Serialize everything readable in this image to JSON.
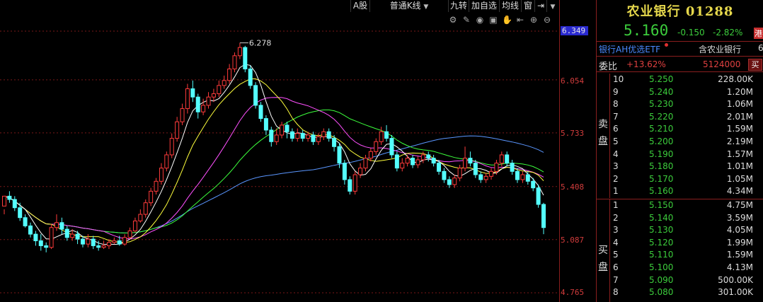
{
  "toolbar": {
    "items": [
      {
        "label": "A股",
        "dropdown": true
      },
      {
        "label": "普通K线",
        "dropdown": true
      },
      {
        "label": "九转",
        "dropdown": false
      },
      {
        "label": "加自选",
        "dropdown": false
      },
      {
        "label": "均线",
        "dropdown": false
      },
      {
        "label": "窗",
        "dropdown": false
      }
    ],
    "icons": [
      "settings-icon",
      "draw-tool-icon",
      "eye-icon",
      "lock-icon",
      "hand-icon",
      "undo-icon",
      "zoom-in-icon",
      "zoom-out-icon"
    ]
  },
  "stock": {
    "title": "农业银行 01288",
    "price": "5.160",
    "change": "-0.150",
    "change_pct": "-2.82%",
    "market_tag": "港",
    "etf_label": "银行AH优选ETF",
    "related_label": "含农业银行",
    "related_count": "6"
  },
  "committee": {
    "label": "委比",
    "ratio": "+13.62%",
    "diff": "5124000",
    "button": "买"
  },
  "sell_label": [
    "卖",
    "盘"
  ],
  "buy_label": [
    "买",
    "盘"
  ],
  "asks": [
    {
      "level": "10",
      "price": "5.250",
      "volume": "228.00K"
    },
    {
      "level": "9",
      "price": "5.240",
      "volume": "1.20M"
    },
    {
      "level": "8",
      "price": "5.230",
      "volume": "1.06M"
    },
    {
      "level": "7",
      "price": "5.220",
      "volume": "2.01M"
    },
    {
      "level": "6",
      "price": "5.210",
      "volume": "1.59M"
    },
    {
      "level": "5",
      "price": "5.200",
      "volume": "2.19M"
    },
    {
      "level": "4",
      "price": "5.190",
      "volume": "1.57M"
    },
    {
      "level": "3",
      "price": "5.180",
      "volume": "1.01M"
    },
    {
      "level": "2",
      "price": "5.170",
      "volume": "1.05M"
    },
    {
      "level": "1",
      "price": "5.160",
      "volume": "4.34M"
    }
  ],
  "bids": [
    {
      "level": "1",
      "price": "5.150",
      "volume": "4.75M"
    },
    {
      "level": "2",
      "price": "5.140",
      "volume": "3.59M"
    },
    {
      "level": "3",
      "price": "5.130",
      "volume": "4.05M"
    },
    {
      "level": "4",
      "price": "5.120",
      "volume": "1.99M"
    },
    {
      "level": "5",
      "price": "5.110",
      "volume": "1.59M"
    },
    {
      "level": "6",
      "price": "5.100",
      "volume": "4.13M"
    },
    {
      "level": "7",
      "price": "5.090",
      "volume": "500.00K"
    },
    {
      "level": "8",
      "price": "5.080",
      "volume": "301.00K"
    }
  ],
  "chart_data": {
    "type": "candlestick",
    "yaxis_ticks": [
      "6.349",
      "6.054",
      "5.733",
      "5.408",
      "5.087",
      "4.765"
    ],
    "yaxis_values": [
      6.349,
      6.054,
      5.733,
      5.408,
      5.087,
      4.765
    ],
    "current_price_label": "6.349",
    "high_annotation": "6.278",
    "colors": {
      "up": "#ff3b3b",
      "down": "#54ffff",
      "ma5": "#ffffff",
      "ma10": "#ffff3c",
      "ma20": "#ff50ff",
      "ma30": "#3cff3c",
      "ma60": "#5a96ff",
      "grid": "#7a1818"
    },
    "candles": [
      [
        5.29,
        5.35,
        5.27,
        5.24
      ],
      [
        5.35,
        5.33,
        5.38,
        5.31
      ],
      [
        5.33,
        5.28,
        5.35,
        5.26
      ],
      [
        5.28,
        5.22,
        5.31,
        5.2
      ],
      [
        5.22,
        5.17,
        5.24,
        5.16
      ],
      [
        5.17,
        5.12,
        5.19,
        5.1
      ],
      [
        5.12,
        5.08,
        5.14,
        5.05
      ],
      [
        5.08,
        5.05,
        5.12,
        5.02
      ],
      [
        5.05,
        5.04,
        5.07,
        5.01
      ],
      [
        5.04,
        5.16,
        5.18,
        5.03
      ],
      [
        5.16,
        5.19,
        5.24,
        5.14
      ],
      [
        5.19,
        5.15,
        5.22,
        5.12
      ],
      [
        5.15,
        5.1,
        5.17,
        5.08
      ],
      [
        5.1,
        5.12,
        5.15,
        5.08
      ],
      [
        5.12,
        5.09,
        5.14,
        5.06
      ],
      [
        5.09,
        5.06,
        5.11,
        5.04
      ],
      [
        5.06,
        5.09,
        5.12,
        5.04
      ],
      [
        5.09,
        5.05,
        5.11,
        5.03
      ],
      [
        5.05,
        5.04,
        5.08,
        5.02
      ],
      [
        5.04,
        5.05,
        5.08,
        5.03
      ],
      [
        5.05,
        5.07,
        5.09,
        5.03
      ],
      [
        5.07,
        5.08,
        5.1,
        5.06
      ],
      [
        5.08,
        5.06,
        5.11,
        5.05
      ],
      [
        5.06,
        5.1,
        5.12,
        5.05
      ],
      [
        5.1,
        5.14,
        5.16,
        5.09
      ],
      [
        5.14,
        5.2,
        5.22,
        5.13
      ],
      [
        5.2,
        5.24,
        5.27,
        5.19
      ],
      [
        5.24,
        5.31,
        5.33,
        5.22
      ],
      [
        5.31,
        5.38,
        5.4,
        5.29
      ],
      [
        5.38,
        5.44,
        5.46,
        5.36
      ],
      [
        5.44,
        5.52,
        5.55,
        5.42
      ],
      [
        5.52,
        5.6,
        5.62,
        5.5
      ],
      [
        5.6,
        5.7,
        5.73,
        5.58
      ],
      [
        5.7,
        5.8,
        5.83,
        5.68
      ],
      [
        5.8,
        5.88,
        5.91,
        5.78
      ],
      [
        5.88,
        6.0,
        6.03,
        5.85
      ],
      [
        6.0,
        5.95,
        6.05,
        5.92
      ],
      [
        5.95,
        5.86,
        5.97,
        5.82
      ],
      [
        5.86,
        5.9,
        5.94,
        5.84
      ],
      [
        5.9,
        5.95,
        5.98,
        5.88
      ],
      [
        5.95,
        5.97,
        6.0,
        5.92
      ],
      [
        5.97,
        6.02,
        6.05,
        5.95
      ],
      [
        6.02,
        6.05,
        6.08,
        6.0
      ],
      [
        6.05,
        6.12,
        6.15,
        6.03
      ],
      [
        6.12,
        6.2,
        6.22,
        6.1
      ],
      [
        6.2,
        6.25,
        6.278,
        6.18
      ],
      [
        6.25,
        6.12,
        6.26,
        6.1
      ],
      [
        6.12,
        6.02,
        6.14,
        6.0
      ],
      [
        6.02,
        5.9,
        6.04,
        5.88
      ],
      [
        5.9,
        5.82,
        5.92,
        5.8
      ],
      [
        5.82,
        5.75,
        5.84,
        5.72
      ],
      [
        5.75,
        5.68,
        5.77,
        5.65
      ],
      [
        5.68,
        5.72,
        5.76,
        5.66
      ],
      [
        5.72,
        5.78,
        5.8,
        5.7
      ],
      [
        5.78,
        5.74,
        5.8,
        5.7
      ],
      [
        5.74,
        5.7,
        5.76,
        5.68
      ],
      [
        5.7,
        5.73,
        5.76,
        5.68
      ],
      [
        5.73,
        5.7,
        5.75,
        5.68
      ],
      [
        5.7,
        5.72,
        5.74,
        5.68
      ],
      [
        5.72,
        5.68,
        5.74,
        5.66
      ],
      [
        5.68,
        5.71,
        5.73,
        5.66
      ],
      [
        5.71,
        5.74,
        5.76,
        5.69
      ],
      [
        5.74,
        5.7,
        5.76,
        5.68
      ],
      [
        5.7,
        5.65,
        5.72,
        5.62
      ],
      [
        5.65,
        5.55,
        5.67,
        5.52
      ],
      [
        5.55,
        5.45,
        5.57,
        5.42
      ],
      [
        5.45,
        5.38,
        5.47,
        5.36
      ],
      [
        5.38,
        5.48,
        5.5,
        5.36
      ],
      [
        5.48,
        5.52,
        5.55,
        5.46
      ],
      [
        5.52,
        5.58,
        5.6,
        5.5
      ],
      [
        5.58,
        5.62,
        5.64,
        5.56
      ],
      [
        5.62,
        5.68,
        5.7,
        5.6
      ],
      [
        5.68,
        5.74,
        5.77,
        5.66
      ],
      [
        5.74,
        5.7,
        5.78,
        5.68
      ],
      [
        5.7,
        5.6,
        5.72,
        5.58
      ],
      [
        5.6,
        5.52,
        5.62,
        5.5
      ],
      [
        5.52,
        5.55,
        5.58,
        5.5
      ],
      [
        5.55,
        5.58,
        5.6,
        5.53
      ],
      [
        5.58,
        5.54,
        5.6,
        5.52
      ],
      [
        5.54,
        5.57,
        5.59,
        5.52
      ],
      [
        5.57,
        5.6,
        5.62,
        5.55
      ],
      [
        5.6,
        5.58,
        5.62,
        5.56
      ],
      [
        5.58,
        5.55,
        5.6,
        5.53
      ],
      [
        5.55,
        5.5,
        5.57,
        5.48
      ],
      [
        5.5,
        5.45,
        5.52,
        5.43
      ],
      [
        5.45,
        5.42,
        5.47,
        5.4
      ],
      [
        5.42,
        5.46,
        5.48,
        5.4
      ],
      [
        5.46,
        5.52,
        5.54,
        5.44
      ],
      [
        5.52,
        5.58,
        5.65,
        5.5
      ],
      [
        5.58,
        5.55,
        5.62,
        5.53
      ],
      [
        5.55,
        5.48,
        5.57,
        5.46
      ],
      [
        5.48,
        5.45,
        5.5,
        5.43
      ],
      [
        5.45,
        5.47,
        5.49,
        5.43
      ],
      [
        5.47,
        5.5,
        5.52,
        5.45
      ],
      [
        5.5,
        5.55,
        5.57,
        5.48
      ],
      [
        5.55,
        5.6,
        5.62,
        5.53
      ],
      [
        5.6,
        5.55,
        5.62,
        5.53
      ],
      [
        5.55,
        5.5,
        5.57,
        5.48
      ],
      [
        5.5,
        5.45,
        5.52,
        5.43
      ],
      [
        5.45,
        5.48,
        5.5,
        5.43
      ],
      [
        5.48,
        5.44,
        5.5,
        5.42
      ],
      [
        5.44,
        5.4,
        5.46,
        5.38
      ],
      [
        5.4,
        5.3,
        5.42,
        5.28
      ],
      [
        5.3,
        5.16,
        5.31,
        5.12
      ]
    ]
  }
}
